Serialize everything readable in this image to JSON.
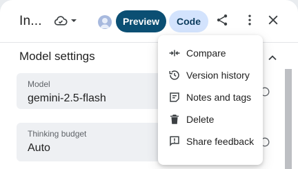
{
  "header": {
    "title": "In...",
    "preview_label": "Preview",
    "code_label": "Code"
  },
  "section": {
    "title": "Model settings"
  },
  "fields": {
    "model": {
      "label": "Model",
      "value": "gemini-2.5-flash"
    },
    "thinking_budget": {
      "label": "Thinking budget",
      "value": "Auto"
    }
  },
  "menu": {
    "items": [
      {
        "label": "Compare",
        "icon": "compare-icon"
      },
      {
        "label": "Version history",
        "icon": "history-icon"
      },
      {
        "label": "Notes and tags",
        "icon": "notes-icon"
      },
      {
        "label": "Delete",
        "icon": "trash-icon"
      },
      {
        "label": "Share feedback",
        "icon": "feedback-icon"
      }
    ]
  },
  "colors": {
    "preview_bg": "#0b4f73",
    "code_bg": "#d3e3fd",
    "field_bg": "#eef0f3"
  }
}
